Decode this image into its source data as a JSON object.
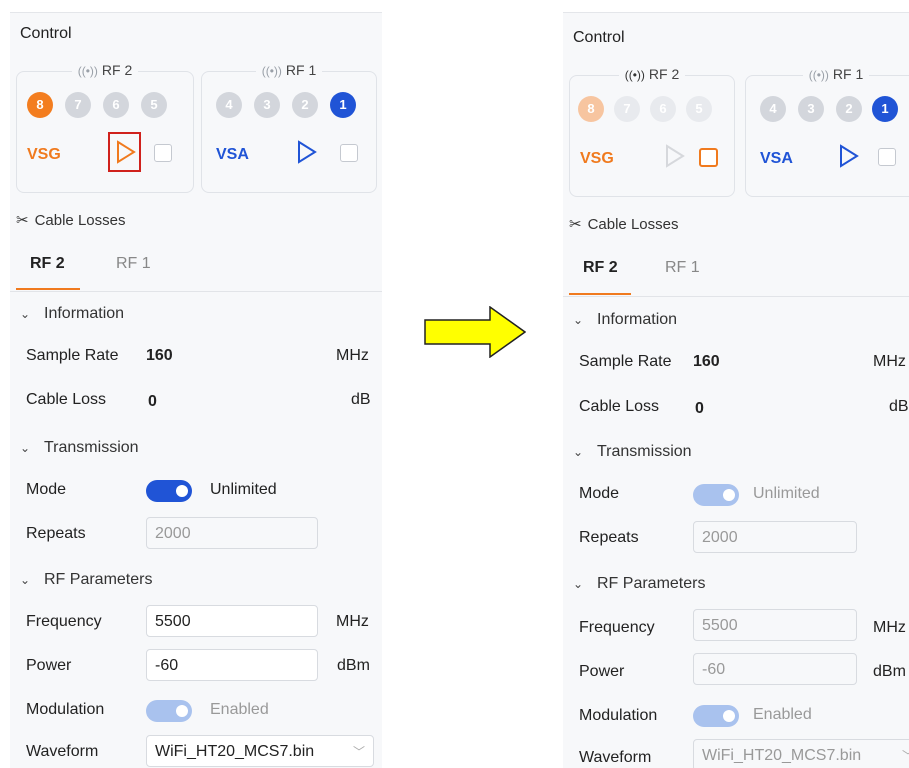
{
  "left": {
    "title": "Control",
    "rf2": {
      "label": "RF 2",
      "ports": [
        "8",
        "7",
        "6",
        "5"
      ]
    },
    "rf1": {
      "label": "RF 1",
      "ports": [
        "4",
        "3",
        "2",
        "1"
      ]
    },
    "vsg_label": "VSG",
    "vsa_label": "VSA",
    "cable_losses": "Cable Losses",
    "tabs": [
      "RF 2",
      "RF 1"
    ],
    "information": "Information",
    "sample_rate_label": "Sample Rate",
    "sample_rate_value": "160",
    "sample_rate_unit": "MHz",
    "cable_loss_label": "Cable Loss",
    "cable_loss_value": "0",
    "cable_loss_unit": "dB",
    "transmission": "Transmission",
    "mode_label": "Mode",
    "mode_value": "Unlimited",
    "repeats_label": "Repeats",
    "repeats_value": "2000",
    "rf_parameters": "RF Parameters",
    "frequency_label": "Frequency",
    "frequency_value": "5500",
    "frequency_unit": "MHz",
    "power_label": "Power",
    "power_value": "-60",
    "power_unit": "dBm",
    "modulation_label": "Modulation",
    "modulation_value": "Enabled",
    "waveform_label": "Waveform",
    "waveform_value": "WiFi_HT20_MCS7.bin"
  },
  "right": {
    "title": "Control",
    "rf2": {
      "label": "RF 2",
      "ports": [
        "8",
        "7",
        "6",
        "5"
      ]
    },
    "rf1": {
      "label": "RF 1",
      "ports": [
        "4",
        "3",
        "2",
        "1"
      ]
    },
    "vsg_label": "VSG",
    "vsa_label": "VSA",
    "cable_losses": "Cable Losses",
    "tabs": [
      "RF 2",
      "RF 1"
    ],
    "information": "Information",
    "sample_rate_label": "Sample Rate",
    "sample_rate_value": "160",
    "sample_rate_unit": "MHz",
    "cable_loss_label": "Cable Loss",
    "cable_loss_value": "0",
    "cable_loss_unit": "dB",
    "transmission": "Transmission",
    "mode_label": "Mode",
    "mode_value": "Unlimited",
    "repeats_label": "Repeats",
    "repeats_value": "2000",
    "rf_parameters": "RF Parameters",
    "frequency_label": "Frequency",
    "frequency_value": "5500",
    "frequency_unit": "MHz",
    "power_label": "Power",
    "power_value": "-60",
    "power_unit": "dBm",
    "modulation_label": "Modulation",
    "modulation_value": "Enabled",
    "waveform_label": "Waveform",
    "waveform_value": "WiFi_HT20_MCS7.bin"
  },
  "colors": {
    "vsg": "#f07a1e",
    "vsa": "#2054d6",
    "highlight": "#d0211c",
    "arrow_fill": "#ffff00"
  },
  "icons": [
    "antenna-icon",
    "play-icon",
    "cable-icon",
    "chevron-down-icon",
    "right-arrow-icon"
  ]
}
